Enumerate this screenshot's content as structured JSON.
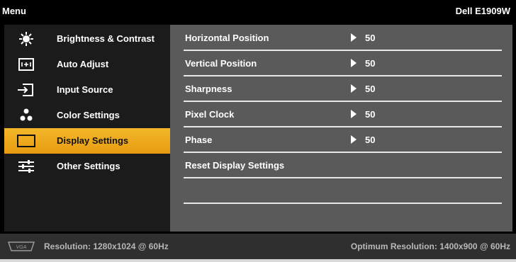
{
  "header": {
    "title": "Menu",
    "model": "Dell E1909W"
  },
  "sidebar": {
    "items": [
      {
        "label": "Brightness & Contrast",
        "icon": "brightness-icon"
      },
      {
        "label": "Auto Adjust",
        "icon": "auto-adjust-icon"
      },
      {
        "label": "Input Source",
        "icon": "input-source-icon"
      },
      {
        "label": "Color Settings",
        "icon": "color-settings-icon"
      },
      {
        "label": "Display Settings",
        "icon": "display-settings-icon",
        "active": true
      },
      {
        "label": "Other Settings",
        "icon": "other-settings-icon"
      }
    ]
  },
  "panel": {
    "rows": [
      {
        "name": "Horizontal Position",
        "value": "50"
      },
      {
        "name": "Vertical Position",
        "value": "50"
      },
      {
        "name": "Sharpness",
        "value": "50"
      },
      {
        "name": "Pixel Clock",
        "value": "50"
      },
      {
        "name": "Phase",
        "value": "50"
      },
      {
        "name": "Reset Display Settings",
        "value": ""
      },
      {
        "name": "",
        "value": ""
      }
    ]
  },
  "footer": {
    "connector_icon": "vga-icon",
    "resolution": "Resolution: 1280x1024 @ 60Hz",
    "optimum": "Optimum Resolution: 1400x900 @ 60Hz"
  },
  "colors": {
    "accent": "#f0aa1c",
    "panel": "#5a5a5a",
    "sidebar": "#1b1b1b"
  }
}
